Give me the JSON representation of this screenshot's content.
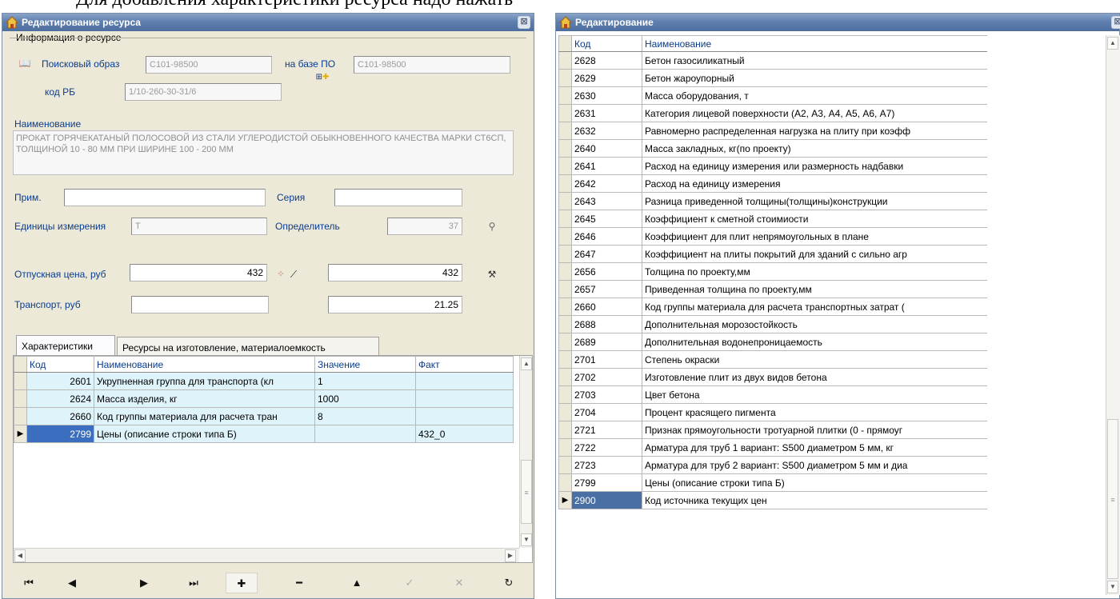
{
  "background_text": "Для добавления характеристики ресурса надо нажать",
  "left_window": {
    "title": "Редактирование ресурса",
    "close_label": "⊠",
    "group_title": "Информация о ресурсе",
    "search_label": "Поисковый образ",
    "search_value": "С101-98500",
    "base_label": "на базе ПО",
    "base_value": "С101-98500",
    "rb_label": "код РБ",
    "rb_value": "1/10-260-30-31/6",
    "name_label": "Наименование",
    "name_value": "ПРОКАТ ГОРЯЧЕКАТАНЫЙ ПОЛОСОВОЙ ИЗ СТАЛИ УГЛЕРОДИСТОЙ ОБЫКНОВЕННОГО КАЧЕСТВА МАРКИ СТ6СП, ТОЛЩИНОЙ 10 - 80 ММ ПРИ ШИРИНЕ 100 - 200 ММ",
    "note_label": "Прим.",
    "note_value": "",
    "series_label": "Серия",
    "series_value": "",
    "unit_label": "Единицы измерения",
    "unit_value": "Т",
    "determinant_label": "Определитель",
    "determinant_value": "37",
    "price_label": "Отпускная цена, руб",
    "price_value": "432",
    "price_value2": "432",
    "transport_label": "Транспорт, руб",
    "transport_value": "",
    "transport_value2": "21.25",
    "tabs": [
      "Характеристики",
      "Ресурсы на изготовление, материалоемкость"
    ],
    "grid_headers": [
      "Код",
      "Наименование",
      "Значение",
      "Факт"
    ],
    "grid_rows": [
      {
        "code": "2601",
        "name": "Укрупненная группа для транспорта (кл",
        "value": "1",
        "fact": ""
      },
      {
        "code": "2624",
        "name": "Масса изделия, кг",
        "value": "1000",
        "fact": ""
      },
      {
        "code": "2660",
        "name": "Код группы материала для расчета тран",
        "value": "8",
        "fact": ""
      },
      {
        "code": "2799",
        "name": "Цены (описание строки типа Б)",
        "value": "",
        "fact": "432_0"
      }
    ],
    "nav_buttons": [
      {
        "name": "first-record-button",
        "glyph": "⏮"
      },
      {
        "name": "prior-record-button",
        "glyph": "◀"
      },
      {
        "name": "next-record-button",
        "glyph": "▶"
      },
      {
        "name": "last-record-button",
        "glyph": "⏭"
      },
      {
        "name": "insert-record-button",
        "glyph": "✚"
      },
      {
        "name": "delete-record-button",
        "glyph": "━"
      },
      {
        "name": "edit-record-button",
        "glyph": "▲"
      },
      {
        "name": "post-record-button",
        "glyph": "✓"
      },
      {
        "name": "cancel-record-button",
        "glyph": "✕"
      },
      {
        "name": "refresh-record-button",
        "glyph": "↻"
      }
    ]
  },
  "right_window": {
    "title": "Редактирование",
    "close_label": "⊠",
    "headers": [
      "Код",
      "Наименование"
    ],
    "rows": [
      {
        "code": "2628",
        "name": "Бетон газосиликатный"
      },
      {
        "code": "2629",
        "name": "Бетон жароупорный"
      },
      {
        "code": "2630",
        "name": "Масса оборудования, т"
      },
      {
        "code": "2631",
        "name": "Категория лицевой поверхности (А2, А3, А4, А5, А6, А7)"
      },
      {
        "code": "2632",
        "name": "Равномерно распределенная нагрузка на плиту при коэфф"
      },
      {
        "code": "2640",
        "name": "Масса закладных, кг(по проекту)"
      },
      {
        "code": "2641",
        "name": "Расход на единицу измерения или размерность надбавки"
      },
      {
        "code": "2642",
        "name": "Расход на единицу измерения"
      },
      {
        "code": "2643",
        "name": "Разница приведенной толщины(толщины)конструкции"
      },
      {
        "code": "2645",
        "name": "Коэффициент к сметной стоимиости"
      },
      {
        "code": "2646",
        "name": "Коэффициент для плит непрямоугольных в плане"
      },
      {
        "code": "2647",
        "name": "Коэффициент на плиты покрытий для зданий с сильно агр"
      },
      {
        "code": "2656",
        "name": "Толщина по проекту,мм"
      },
      {
        "code": "2657",
        "name": "Приведенная толщина по проекту,мм"
      },
      {
        "code": "2660",
        "name": "Код группы материала для расчета транспортных затрат ("
      },
      {
        "code": "2688",
        "name": "Дополнительная морозостойкость"
      },
      {
        "code": "2689",
        "name": "Дополнительная водонепроницаемость"
      },
      {
        "code": "2701",
        "name": "Степень окраски"
      },
      {
        "code": "2702",
        "name": "Изготовление плит из двух видов бетона"
      },
      {
        "code": "2703",
        "name": "Цвет бетона"
      },
      {
        "code": "2704",
        "name": "Процент красящего пигмента"
      },
      {
        "code": "2721",
        "name": "Признак прямоугольности тротуарной плитки  (0 - прямоуг"
      },
      {
        "code": "2722",
        "name": "Арматура для труб 1 вариант: S500 диаметром 5 мм, кг"
      },
      {
        "code": "2723",
        "name": "Арматура для труб 2 вариант: S500 диаметром 5 мм и диа"
      },
      {
        "code": "2799",
        "name": "Цены (описание строки типа Б)"
      },
      {
        "code": "2900",
        "name": "Код источника текущих цен"
      }
    ]
  }
}
